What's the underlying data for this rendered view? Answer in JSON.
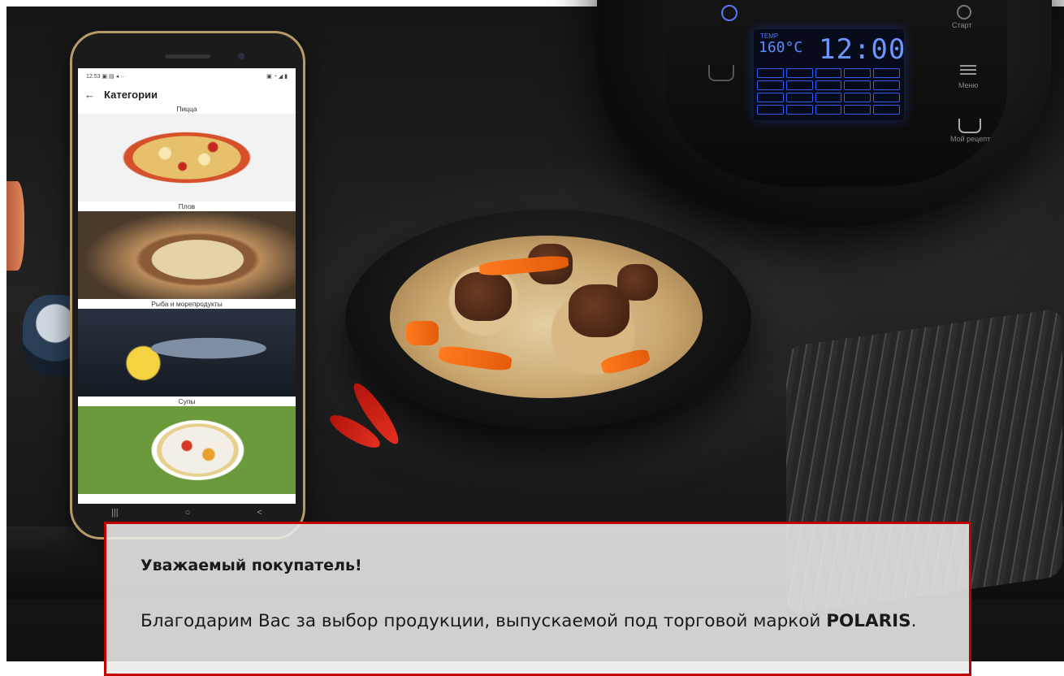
{
  "cooker": {
    "lcd_temp_label": "TEMP",
    "lcd_temperature": "160°C",
    "lcd_time": "12:00",
    "side_labels": [
      "Старт",
      "Меню",
      "Мой рецепт"
    ]
  },
  "phone": {
    "status_time": "12:53",
    "status_icons": "▣ ▤ ◂ ···",
    "status_right": "▣ ◔ ◢ ▮",
    "screen_title": "Категории",
    "back_icon": "←",
    "categories": [
      {
        "label": "Пицца"
      },
      {
        "label": "Плов"
      },
      {
        "label": "Рыба и морепродукты"
      },
      {
        "label": "Супы"
      }
    ],
    "nav": {
      "recent": "|||",
      "home": "○",
      "back": "<"
    }
  },
  "notice": {
    "title": "Уважаемый покупатель!",
    "body_prefix": "Благодарим Вас за выбор продукции, выпускаемой под торговой маркой ",
    "brand": "POLARIS",
    "body_suffix": "."
  },
  "colors": {
    "notice_border": "#c00000",
    "lcd_blue": "#6b96ff",
    "phone_frame": "#b79a6a"
  }
}
